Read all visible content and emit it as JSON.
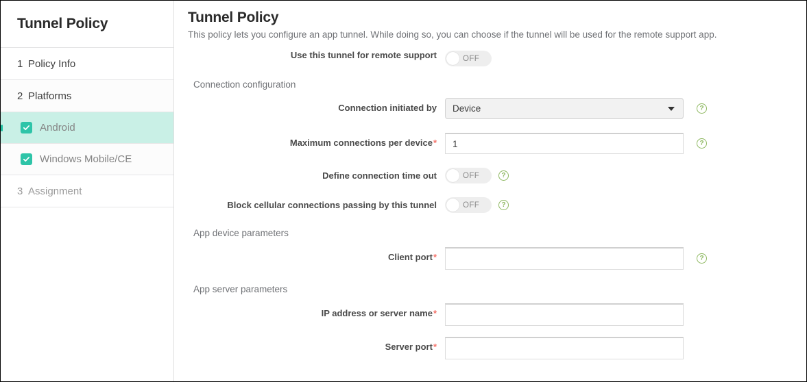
{
  "sidebar": {
    "title": "Tunnel Policy",
    "steps": [
      {
        "num": "1",
        "label": "Policy Info"
      },
      {
        "num": "2",
        "label": "Platforms"
      },
      {
        "num": "3",
        "label": "Assignment"
      }
    ],
    "platforms": [
      {
        "label": "Android",
        "checked": true,
        "selected": true
      },
      {
        "label": "Windows Mobile/CE",
        "checked": true,
        "selected": false
      }
    ]
  },
  "main": {
    "title": "Tunnel Policy",
    "description": "This policy lets you configure an app tunnel. While doing so, you can choose if the tunnel will be used for the remote support app.",
    "remote_support": {
      "label": "Use this tunnel for remote support",
      "toggle_value": "OFF"
    },
    "connection_section": {
      "heading": "Connection configuration",
      "initiated_by": {
        "label": "Connection initiated by",
        "value": "Device",
        "help": "?"
      },
      "max_connections": {
        "label": "Maximum connections per device",
        "required": "*",
        "value": "1",
        "help": "?"
      },
      "define_timeout": {
        "label": "Define connection time out",
        "toggle_value": "OFF",
        "help": "?"
      },
      "block_cellular": {
        "label": "Block cellular connections passing by this tunnel",
        "toggle_value": "OFF",
        "help": "?"
      }
    },
    "app_device_section": {
      "heading": "App device parameters",
      "client_port": {
        "label": "Client port",
        "required": "*",
        "value": "",
        "help": "?"
      }
    },
    "app_server_section": {
      "heading": "App server parameters",
      "ip_address": {
        "label": "IP address or server name",
        "required": "*",
        "value": ""
      },
      "server_port": {
        "label": "Server port",
        "required": "*",
        "value": ""
      }
    }
  },
  "colors": {
    "accent_teal": "#2ec4a8",
    "selected_row": "#c9f0e6",
    "help_green": "#8eb860",
    "required_red": "#f4736a"
  }
}
